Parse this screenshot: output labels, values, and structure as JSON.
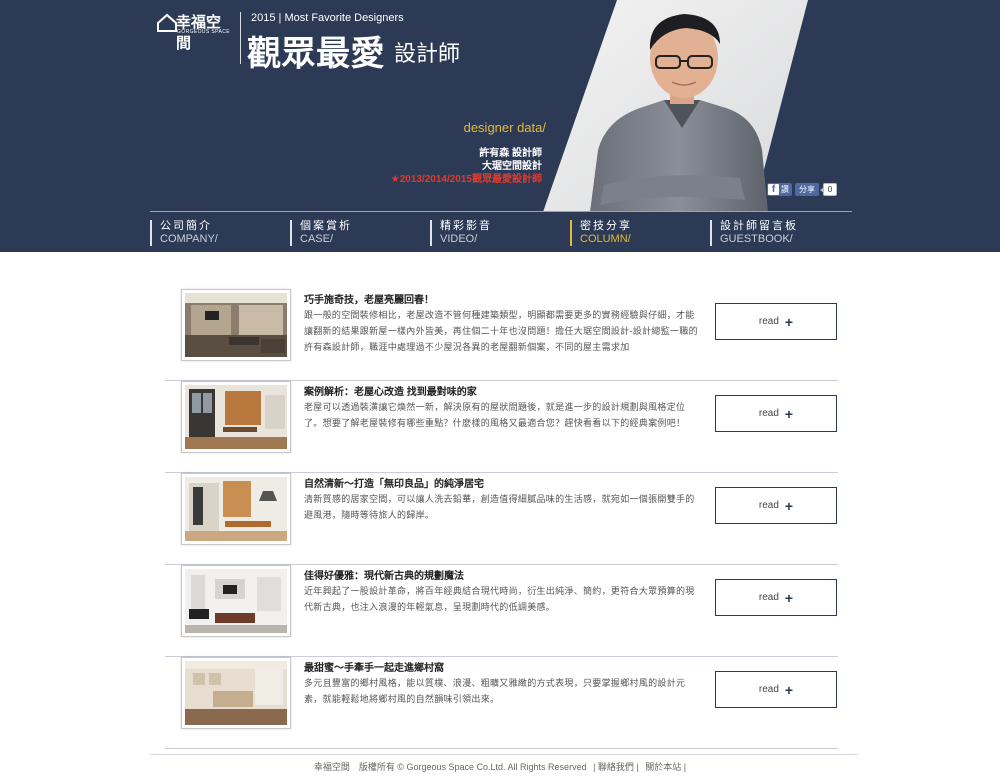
{
  "header": {
    "logo_text": "幸福空間",
    "logo_subtext": "GORGEOUS SPACE",
    "title_year_line": "2015 | Most Favorite Designers",
    "title_main": "觀眾最愛",
    "title_sub": "設計師",
    "designer_label": "designer data/",
    "designer_name": "許有森 設計師",
    "designer_company": "大琚空間設計",
    "designer_award": "★2013/2014/2015觀眾最愛設計師",
    "share": {
      "fb_label": "讚",
      "share_label": "分享",
      "count": "0"
    }
  },
  "nav": [
    {
      "zh": "公司簡介",
      "en": "COMPANY/",
      "active": false
    },
    {
      "zh": "個案賞析",
      "en": "CASE/",
      "active": false
    },
    {
      "zh": "精彩影音",
      "en": "VIDEO/",
      "active": false
    },
    {
      "zh": "密技分享",
      "en": "COLUMN/",
      "active": true
    },
    {
      "zh": "設計師留言板",
      "en": "GUESTBOOK/",
      "active": false
    }
  ],
  "articles": [
    {
      "title": "巧手施奇技，老屋亮麗回春！",
      "body": "跟一般的空間裝修相比，老屋改造不管何種建築類型，明顯都需要更多的實務經驗與仔細，才能讓翻新的結果跟新屋一樣內外皆美，再住個二十年也沒問題！擔任大琚空間設計-設計總監一職的許有森設計師，職涯中處理過不少屋況各異的老屋翻新個案，不同的屋主需求加",
      "read_label": "read"
    },
    {
      "title": "案例解析：老屋心改造 找到最對味的家",
      "body": "老屋可以透過裝潢讓它煥然一新，解決原有的屋狀問題後，就是進一步的設計規劃與風格定位了。想要了解老屋裝修有哪些重點？什麼樣的風格又最適合您？趕快看看以下的經典案例吧！",
      "read_label": "read"
    },
    {
      "title": "自然清新～打造「無印良品」的純淨居宅",
      "body": "清新質感的居家空間，可以讓人洗去鉛華，創造值得細膩品味的生活感，就宛如一個張開雙手的避風港，隨時等待旅人的歸岸。",
      "read_label": "read"
    },
    {
      "title": "佳得好優雅：現代新古典的規劃魔法",
      "body": "近年興起了一股設計革命，將百年經典結合現代時尚，衍生出純淨、簡約，更符合大眾預算的現代新古典，也注入浪漫的年輕氣息，呈現劃時代的低調美感。",
      "read_label": "read"
    },
    {
      "title": "最甜蜜～手牽手一起走進鄉村窩",
      "body": "多元且豐富的鄉村風格，能以質樸、浪漫、粗曠又雅緻的方式表現，只要掌握鄉村風的設計元素，就能輕鬆地將鄉村風的自然韻味引領出來。",
      "read_label": "read"
    }
  ],
  "footer": {
    "copyright": "幸福空間　版權所有 © Gorgeous Space Co.Ltd. All Rights Reserved",
    "contact": "| 聯絡我們 |",
    "about": "關於本站 |"
  },
  "colors": {
    "header_bg": "#2c3a55",
    "accent_gold": "#e5b93c",
    "award_red": "#e03b2e",
    "facebook_blue": "#4e69a2"
  }
}
